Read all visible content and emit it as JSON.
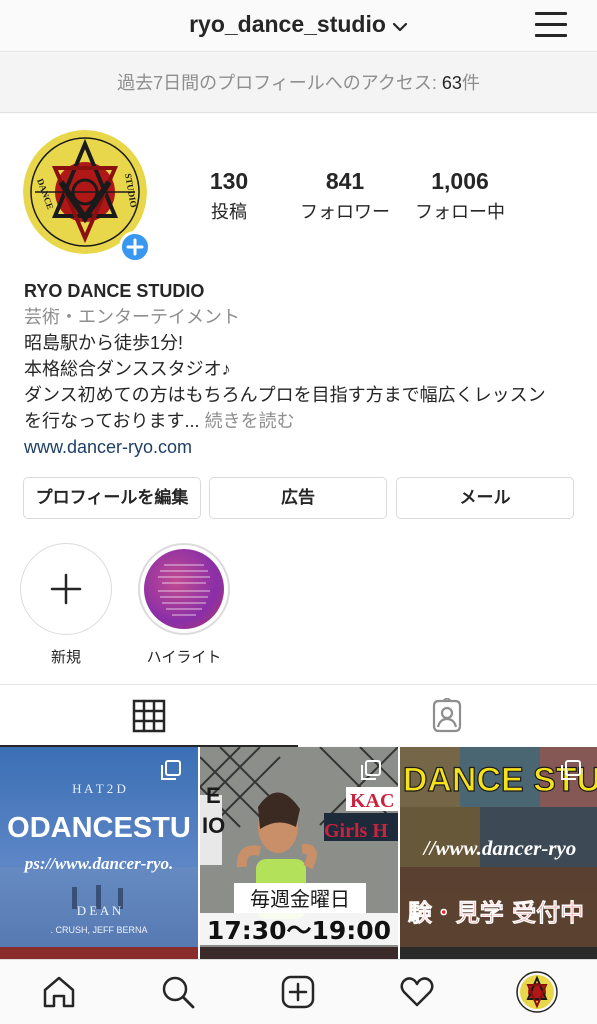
{
  "header": {
    "username": "ryo_dance_studio"
  },
  "insights": {
    "text": "過去7日間のプロフィールへのアクセス: ",
    "count": "63",
    "suffix": "件"
  },
  "profile": {
    "stats": [
      {
        "value": "130",
        "label": "投稿"
      },
      {
        "value": "841",
        "label": "フォロワー"
      },
      {
        "value": "1,006",
        "label": "フォロー中"
      }
    ],
    "display_name": "RYO DANCE STUDIO",
    "category": "芸術・エンターテイメント",
    "bio_lines": [
      "昭島駅から徒歩1分!",
      "本格総合ダンススタジオ♪",
      "ダンス初めての方はもちろんプロを目指す方まで幅広くレッスン",
      "を行なっております..."
    ],
    "more_label": "続きを読む",
    "website": "www.dancer-ryo.com",
    "avatar_lettering": [
      "DANCE",
      "STUDIO"
    ]
  },
  "buttons": {
    "edit_profile": "プロフィールを編集",
    "ads": "広告",
    "email": "メール"
  },
  "highlights": [
    {
      "label": "新規"
    },
    {
      "label": "ハイライト"
    }
  ],
  "grid": {
    "tile1": {
      "top_text": "H A T   2   D",
      "main_text": "ODANCESTU",
      "url_text": "ps://www.dancer-ryo.",
      "bottom_text": "D E A N",
      "small_text": ". CRUSH, JEFF BERNA"
    },
    "tile2": {
      "side_text_1": "E",
      "side_text_2": "IO",
      "sign_1": "KAC",
      "sign_2": "Girls H",
      "day_text": "毎週金曜日",
      "time_text": "17:30〜19:00"
    },
    "tile3": {
      "title_text": "DANCE STU",
      "url_text": "//www.dancer-ryo",
      "bottom_text": "験・見学 受付中"
    }
  },
  "colors": {
    "accent_blue": "#3897f0",
    "link_blue": "#1e3f67",
    "muted_gray": "#8e8e8e"
  },
  "icons": {
    "bottom_nav": [
      "home-icon",
      "search-icon",
      "new-post-icon",
      "activity-heart-icon",
      "profile-avatar-icon"
    ]
  }
}
